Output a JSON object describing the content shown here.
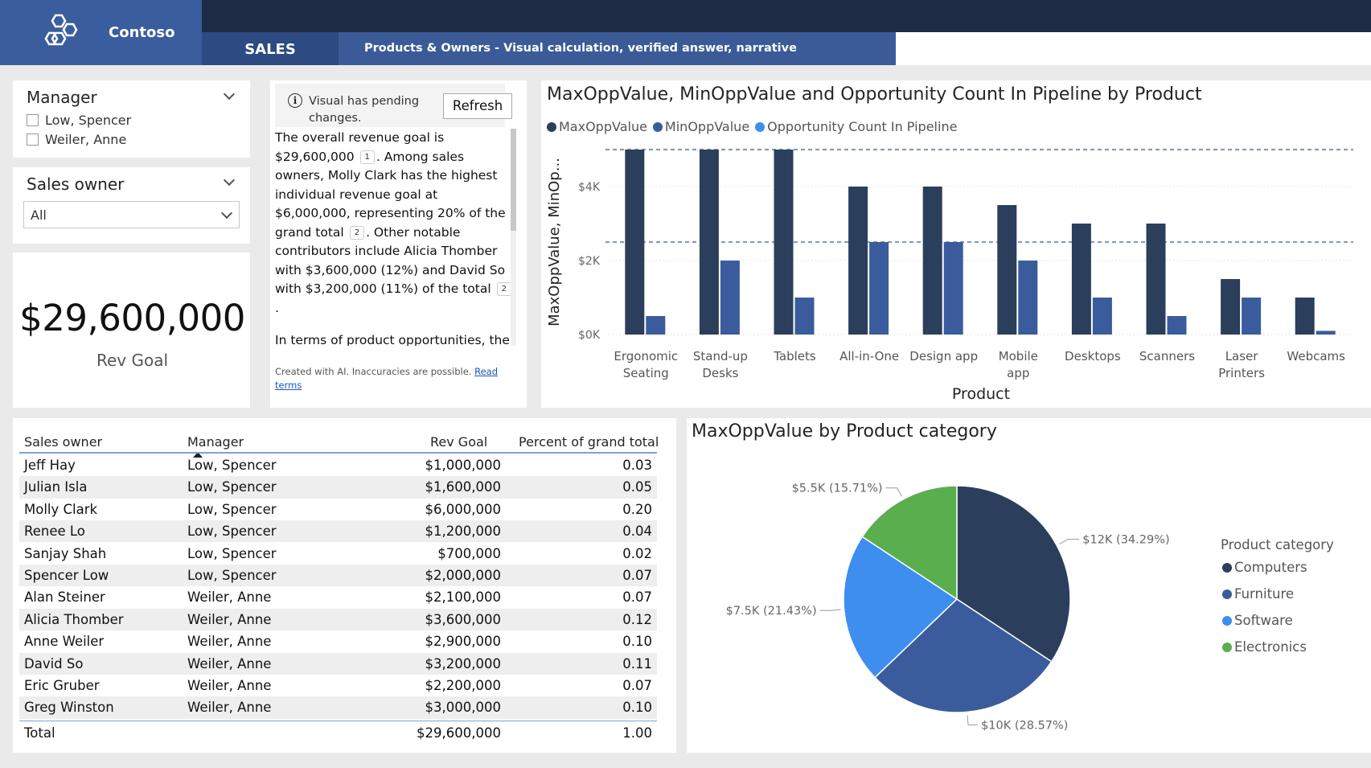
{
  "header": {
    "brand_name": "Contoso",
    "tab_label": "SALES",
    "page_title": "Products & Owners - Visual calculation, verified answer, narrative"
  },
  "manager_slicer": {
    "title": "Manager",
    "options": [
      "Low, Spencer",
      "Weiler, Anne"
    ]
  },
  "sales_owner_slicer": {
    "title": "Sales owner",
    "selected": "All"
  },
  "kpi": {
    "value": "$29,600,000",
    "label": "Rev Goal"
  },
  "narrative": {
    "pending_text": "Visual has pending changes.",
    "refresh_label": "Refresh",
    "p1_a": "The overall revenue goal is $29,600,000",
    "ref1": "1",
    "p1_b": ". Among sales owners, Molly Clark has the highest individual revenue goal at $6,000,000, representing 20% of the grand total",
    "ref2": "2",
    "p1_c": ". Other notable contributors include Alicia Thomber with $3,600,000 (12%) and David So with $3,200,000 (11%) of the total",
    "ref3": "2",
    "p1_d": ".",
    "p2": "In terms of product opportunities, the maximum opportunity value",
    "disclaimer": "Created with AI. Inaccuracies are possible.",
    "read_terms": "Read terms"
  },
  "colors": {
    "max_series": "#2b3f5c",
    "min_series": "#3a5c9c",
    "count_series": "#3e8ef0",
    "electronics": "#5aae4e",
    "header_dark": "#1e2b44",
    "brand_blue": "#3a5d9e"
  },
  "chart_data": [
    {
      "type": "bar",
      "title": "MaxOppValue, MinOppValue and Opportunity Count In Pipeline by Product",
      "xlabel": "Product",
      "ylabel": "MaxOppValue, MinOp...",
      "categories": [
        "Ergonomic Seating",
        "Stand-up Desks",
        "Tablets",
        "All-in-One",
        "Design app",
        "Mobile app",
        "Desktops",
        "Scanners",
        "Laser Printers",
        "Webcams"
      ],
      "series": [
        {
          "name": "MaxOppValue",
          "values": [
            5000,
            5000,
            5000,
            4000,
            4000,
            3500,
            3000,
            3000,
            1500,
            1000
          ]
        },
        {
          "name": "MinOppValue",
          "values": [
            500,
            2000,
            1000,
            2500,
            2500,
            2000,
            1000,
            500,
            1000,
            100
          ]
        },
        {
          "name": "Opportunity Count In Pipeline",
          "values": [
            0,
            0,
            0,
            0,
            0,
            0,
            0,
            0,
            0,
            0
          ]
        }
      ],
      "yticks": [
        "$0K",
        "$2K",
        "$4K"
      ],
      "ylim": [
        0,
        5000
      ],
      "reference_lines": [
        5000,
        2500
      ],
      "legend": "top-left",
      "grid": true
    },
    {
      "type": "pie",
      "title": "MaxOppValue by Product category",
      "legend_title": "Product category",
      "slices": [
        {
          "name": "Computers",
          "value": 12000,
          "label": "$12K (34.29%)"
        },
        {
          "name": "Furniture",
          "value": 10000,
          "label": "$10K (28.57%)"
        },
        {
          "name": "Software",
          "value": 7500,
          "label": "$7.5K (21.43%)"
        },
        {
          "name": "Electronics",
          "value": 5500,
          "label": "$5.5K (15.71%)"
        }
      ],
      "legend": "right"
    }
  ],
  "table": {
    "headers": [
      "Sales owner",
      "Manager",
      "Rev Goal",
      "Percent of grand total"
    ],
    "rows": [
      [
        "Jeff Hay",
        "Low, Spencer",
        "$1,000,000",
        "0.03"
      ],
      [
        "Julian Isla",
        "Low, Spencer",
        "$1,600,000",
        "0.05"
      ],
      [
        "Molly Clark",
        "Low, Spencer",
        "$6,000,000",
        "0.20"
      ],
      [
        "Renee Lo",
        "Low, Spencer",
        "$1,200,000",
        "0.04"
      ],
      [
        "Sanjay Shah",
        "Low, Spencer",
        "$700,000",
        "0.02"
      ],
      [
        "Spencer Low",
        "Low, Spencer",
        "$2,000,000",
        "0.07"
      ],
      [
        "Alan Steiner",
        "Weiler, Anne",
        "$2,100,000",
        "0.07"
      ],
      [
        "Alicia Thomber",
        "Weiler, Anne",
        "$3,600,000",
        "0.12"
      ],
      [
        "Anne Weiler",
        "Weiler, Anne",
        "$2,900,000",
        "0.10"
      ],
      [
        "David So",
        "Weiler, Anne",
        "$3,200,000",
        "0.11"
      ],
      [
        "Eric Gruber",
        "Weiler, Anne",
        "$2,200,000",
        "0.07"
      ],
      [
        "Greg Winston",
        "Weiler, Anne",
        "$3,000,000",
        "0.10"
      ]
    ],
    "total": [
      "Total",
      "",
      "$29,600,000",
      "1.00"
    ]
  }
}
